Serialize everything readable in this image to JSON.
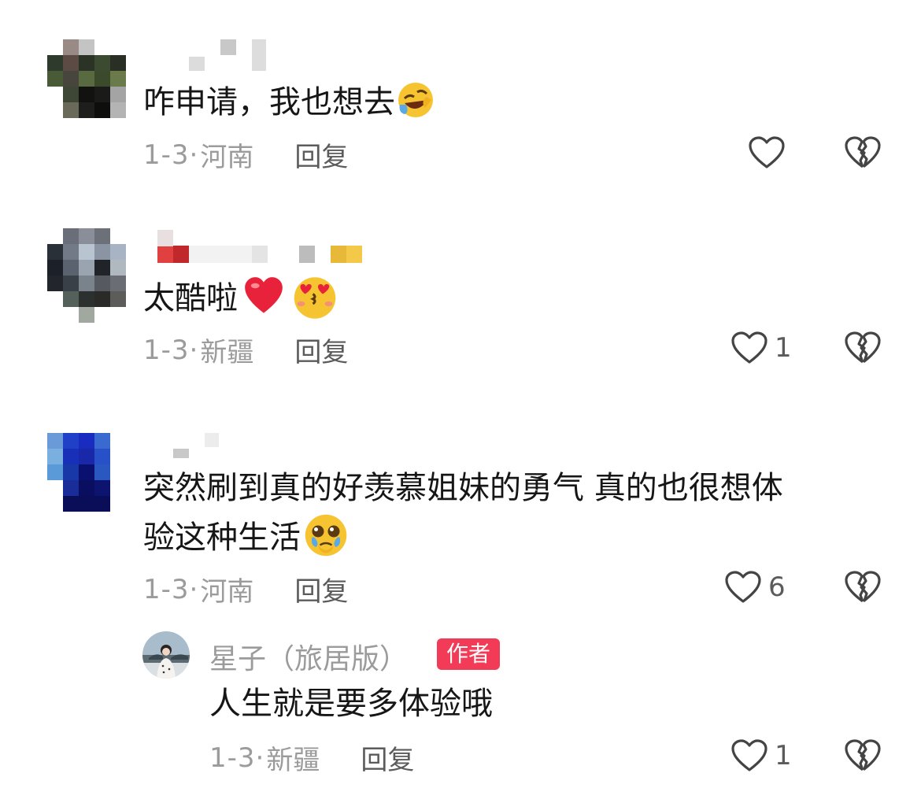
{
  "comments": [
    {
      "text": "咋申请，我也想去",
      "emojis": [
        "rolling-laughing-emoji"
      ],
      "date": "1-3·",
      "location": "河南",
      "reply_label": "回复",
      "likes": ""
    },
    {
      "text": "太酷啦",
      "emojis": [
        "red-heart-emoji",
        "kissing-heart-eyes-emoji"
      ],
      "date": "1-3·",
      "location": "新疆",
      "reply_label": "回复",
      "likes": "1"
    },
    {
      "text_line1": "突然刷到真的好羡慕姐妹的勇气 真的也很想体",
      "text_line2": "验这种生活",
      "emojis": [
        "pleading-tears-emoji"
      ],
      "date": "1-3·",
      "location": "河南",
      "reply_label": "回复",
      "likes": "6"
    }
  ],
  "reply": {
    "username": "星子（旅居版）",
    "badge": "作者",
    "text": "人生就是要多体验哦",
    "date": "1-3·",
    "location": "新疆",
    "reply_label": "回复",
    "likes": "1"
  },
  "colors": {
    "primary_text": "#161616",
    "meta_text": "#9b9b9b",
    "action_text": "#5b5b5b",
    "author_badge": "#f23b57"
  }
}
